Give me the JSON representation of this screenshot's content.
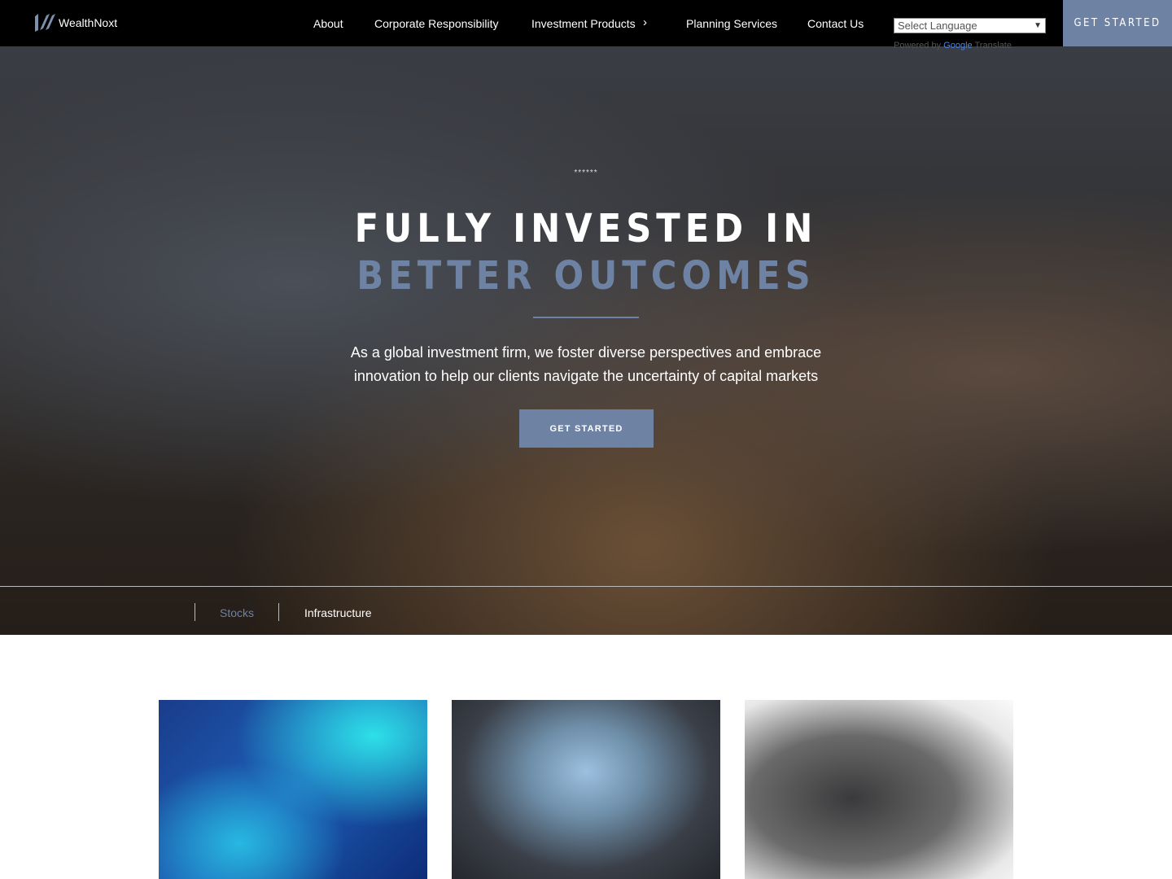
{
  "nav": {
    "brand": "WealthNoxt",
    "items": [
      "About",
      "Corporate Responsibility",
      "Investment Products",
      "Planning Services",
      "Contact Us"
    ],
    "language_select": "Select Language",
    "powered_by": "Powered by",
    "google": "Google",
    "translate": "Translate",
    "cta": "GET STARTED"
  },
  "hero": {
    "stars": "******",
    "title_line1": "FULLY INVESTED IN",
    "title_line2": "BETTER OUTCOMES",
    "subtitle_line1": "As a global investment firm, we foster diverse perspectives and embrace",
    "subtitle_line2": "innovation to help our clients navigate the uncertainty of capital markets",
    "cta": "GET STARTED"
  },
  "tabs": [
    {
      "label": "Stocks",
      "active": true
    },
    {
      "label": "Infrastructure",
      "active": false
    }
  ],
  "colors": {
    "accent": "#6e83a3",
    "nav_bg": "#000000"
  }
}
